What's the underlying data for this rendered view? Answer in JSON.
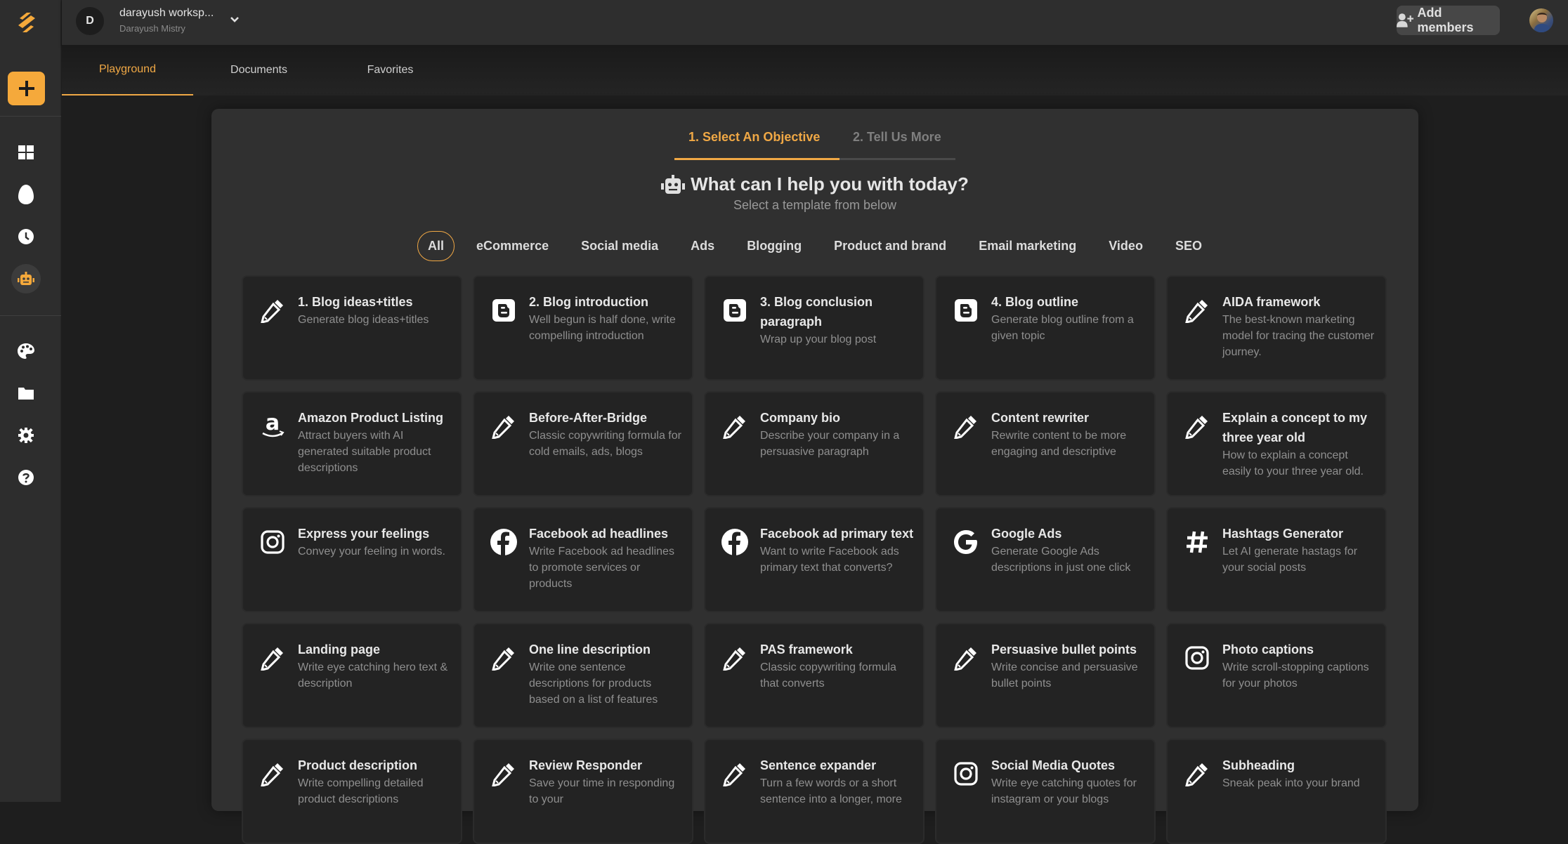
{
  "workspace": {
    "initial": "D",
    "name": "darayush worksp...",
    "user": "Darayush Mistry"
  },
  "header": {
    "add_members_label": "Add members"
  },
  "sidebar": {
    "items": [
      {
        "icon": "dashboard-icon"
      },
      {
        "icon": "egg-icon"
      },
      {
        "icon": "history-clock-icon"
      },
      {
        "icon": "robot-icon",
        "active": true
      },
      {
        "icon": "palette-icon"
      },
      {
        "icon": "folder-icon"
      },
      {
        "icon": "settings-gear-icon"
      },
      {
        "icon": "help-icon"
      }
    ]
  },
  "tabs": [
    {
      "label": "Playground",
      "active": true
    },
    {
      "label": "Documents"
    },
    {
      "label": "Favorites"
    }
  ],
  "steps": {
    "step1": "1. Select An Objective",
    "step2": "2. Tell Us More",
    "progress_fraction": 0.5
  },
  "main": {
    "heading": "What can I help you with today?",
    "subheading": "Select a template from below"
  },
  "filters": [
    {
      "label": "All",
      "active": true
    },
    {
      "label": "eCommerce"
    },
    {
      "label": "Social media"
    },
    {
      "label": "Ads"
    },
    {
      "label": "Blogging"
    },
    {
      "label": "Product and brand"
    },
    {
      "label": "Email marketing"
    },
    {
      "label": "Video"
    },
    {
      "label": "SEO"
    }
  ],
  "templates": [
    {
      "icon": "pencil",
      "title": "1. Blog ideas+titles",
      "desc": "Generate blog ideas+titles"
    },
    {
      "icon": "blogger",
      "title": "2. Blog introduction",
      "desc": "Well begun is half done, write compelling introduction"
    },
    {
      "icon": "blogger",
      "title": "3. Blog conclusion paragraph",
      "desc": "Wrap up your blog post"
    },
    {
      "icon": "blogger",
      "title": "4. Blog outline",
      "desc": "Generate blog outline from a given topic"
    },
    {
      "icon": "pencil",
      "title": "AIDA framework",
      "desc": "The best-known marketing model for tracing the customer journey."
    },
    {
      "icon": "amazon",
      "title": "Amazon Product Listing",
      "desc": "Attract buyers with AI generated suitable product descriptions"
    },
    {
      "icon": "pencil",
      "title": "Before-After-Bridge",
      "desc": "Classic copywriting formula for cold emails, ads, blogs"
    },
    {
      "icon": "pencil",
      "title": "Company bio",
      "desc": "Describe your company in a persuasive paragraph"
    },
    {
      "icon": "pencil",
      "title": "Content rewriter",
      "desc": "Rewrite content to be more engaging and descriptive"
    },
    {
      "icon": "pencil",
      "title": "Explain a concept to my three year old",
      "desc": "How to explain a concept easily to your three year old."
    },
    {
      "icon": "instagram",
      "title": "Express your feelings",
      "desc": "Convey your feeling in words."
    },
    {
      "icon": "facebook",
      "title": "Facebook ad headlines",
      "desc": "Write Facebook ad headlines to promote services or products"
    },
    {
      "icon": "facebook",
      "title": "Facebook ad primary text",
      "desc": "Want to write Facebook ads primary text that converts?"
    },
    {
      "icon": "google",
      "title": "Google Ads",
      "desc": "Generate Google Ads descriptions in just one click"
    },
    {
      "icon": "hashtag",
      "title": "Hashtags Generator",
      "desc": "Let AI generate hastags for your social posts"
    },
    {
      "icon": "pencil",
      "title": "Landing page",
      "desc": "Write eye catching hero text & description"
    },
    {
      "icon": "pencil",
      "title": "One line description",
      "desc": "Write one sentence descriptions for products based on a list of features"
    },
    {
      "icon": "pencil",
      "title": "PAS framework",
      "desc": "Classic copywriting formula that converts"
    },
    {
      "icon": "pencil",
      "title": "Persuasive bullet points",
      "desc": "Write concise and persuasive bullet points"
    },
    {
      "icon": "instagram",
      "title": "Photo captions",
      "desc": "Write scroll-stopping captions for your photos"
    },
    {
      "icon": "pencil",
      "title": "Product description",
      "desc": "Write compelling detailed product descriptions"
    },
    {
      "icon": "pencil",
      "title": "Review Responder",
      "desc": "Save your time in responding to your"
    },
    {
      "icon": "pencil",
      "title": "Sentence expander",
      "desc": "Turn a few words or a short sentence into a longer, more"
    },
    {
      "icon": "instagram",
      "title": "Social Media Quotes",
      "desc": "Write eye catching quotes for instagram or your blogs"
    },
    {
      "icon": "pencil",
      "title": "Subheading",
      "desc": "Sneak peak into your brand"
    }
  ],
  "colors": {
    "accent": "#f0a845",
    "sidebar_bg": "#2d2d2d",
    "panel_bg": "#303030",
    "card_bg": "#232323"
  }
}
